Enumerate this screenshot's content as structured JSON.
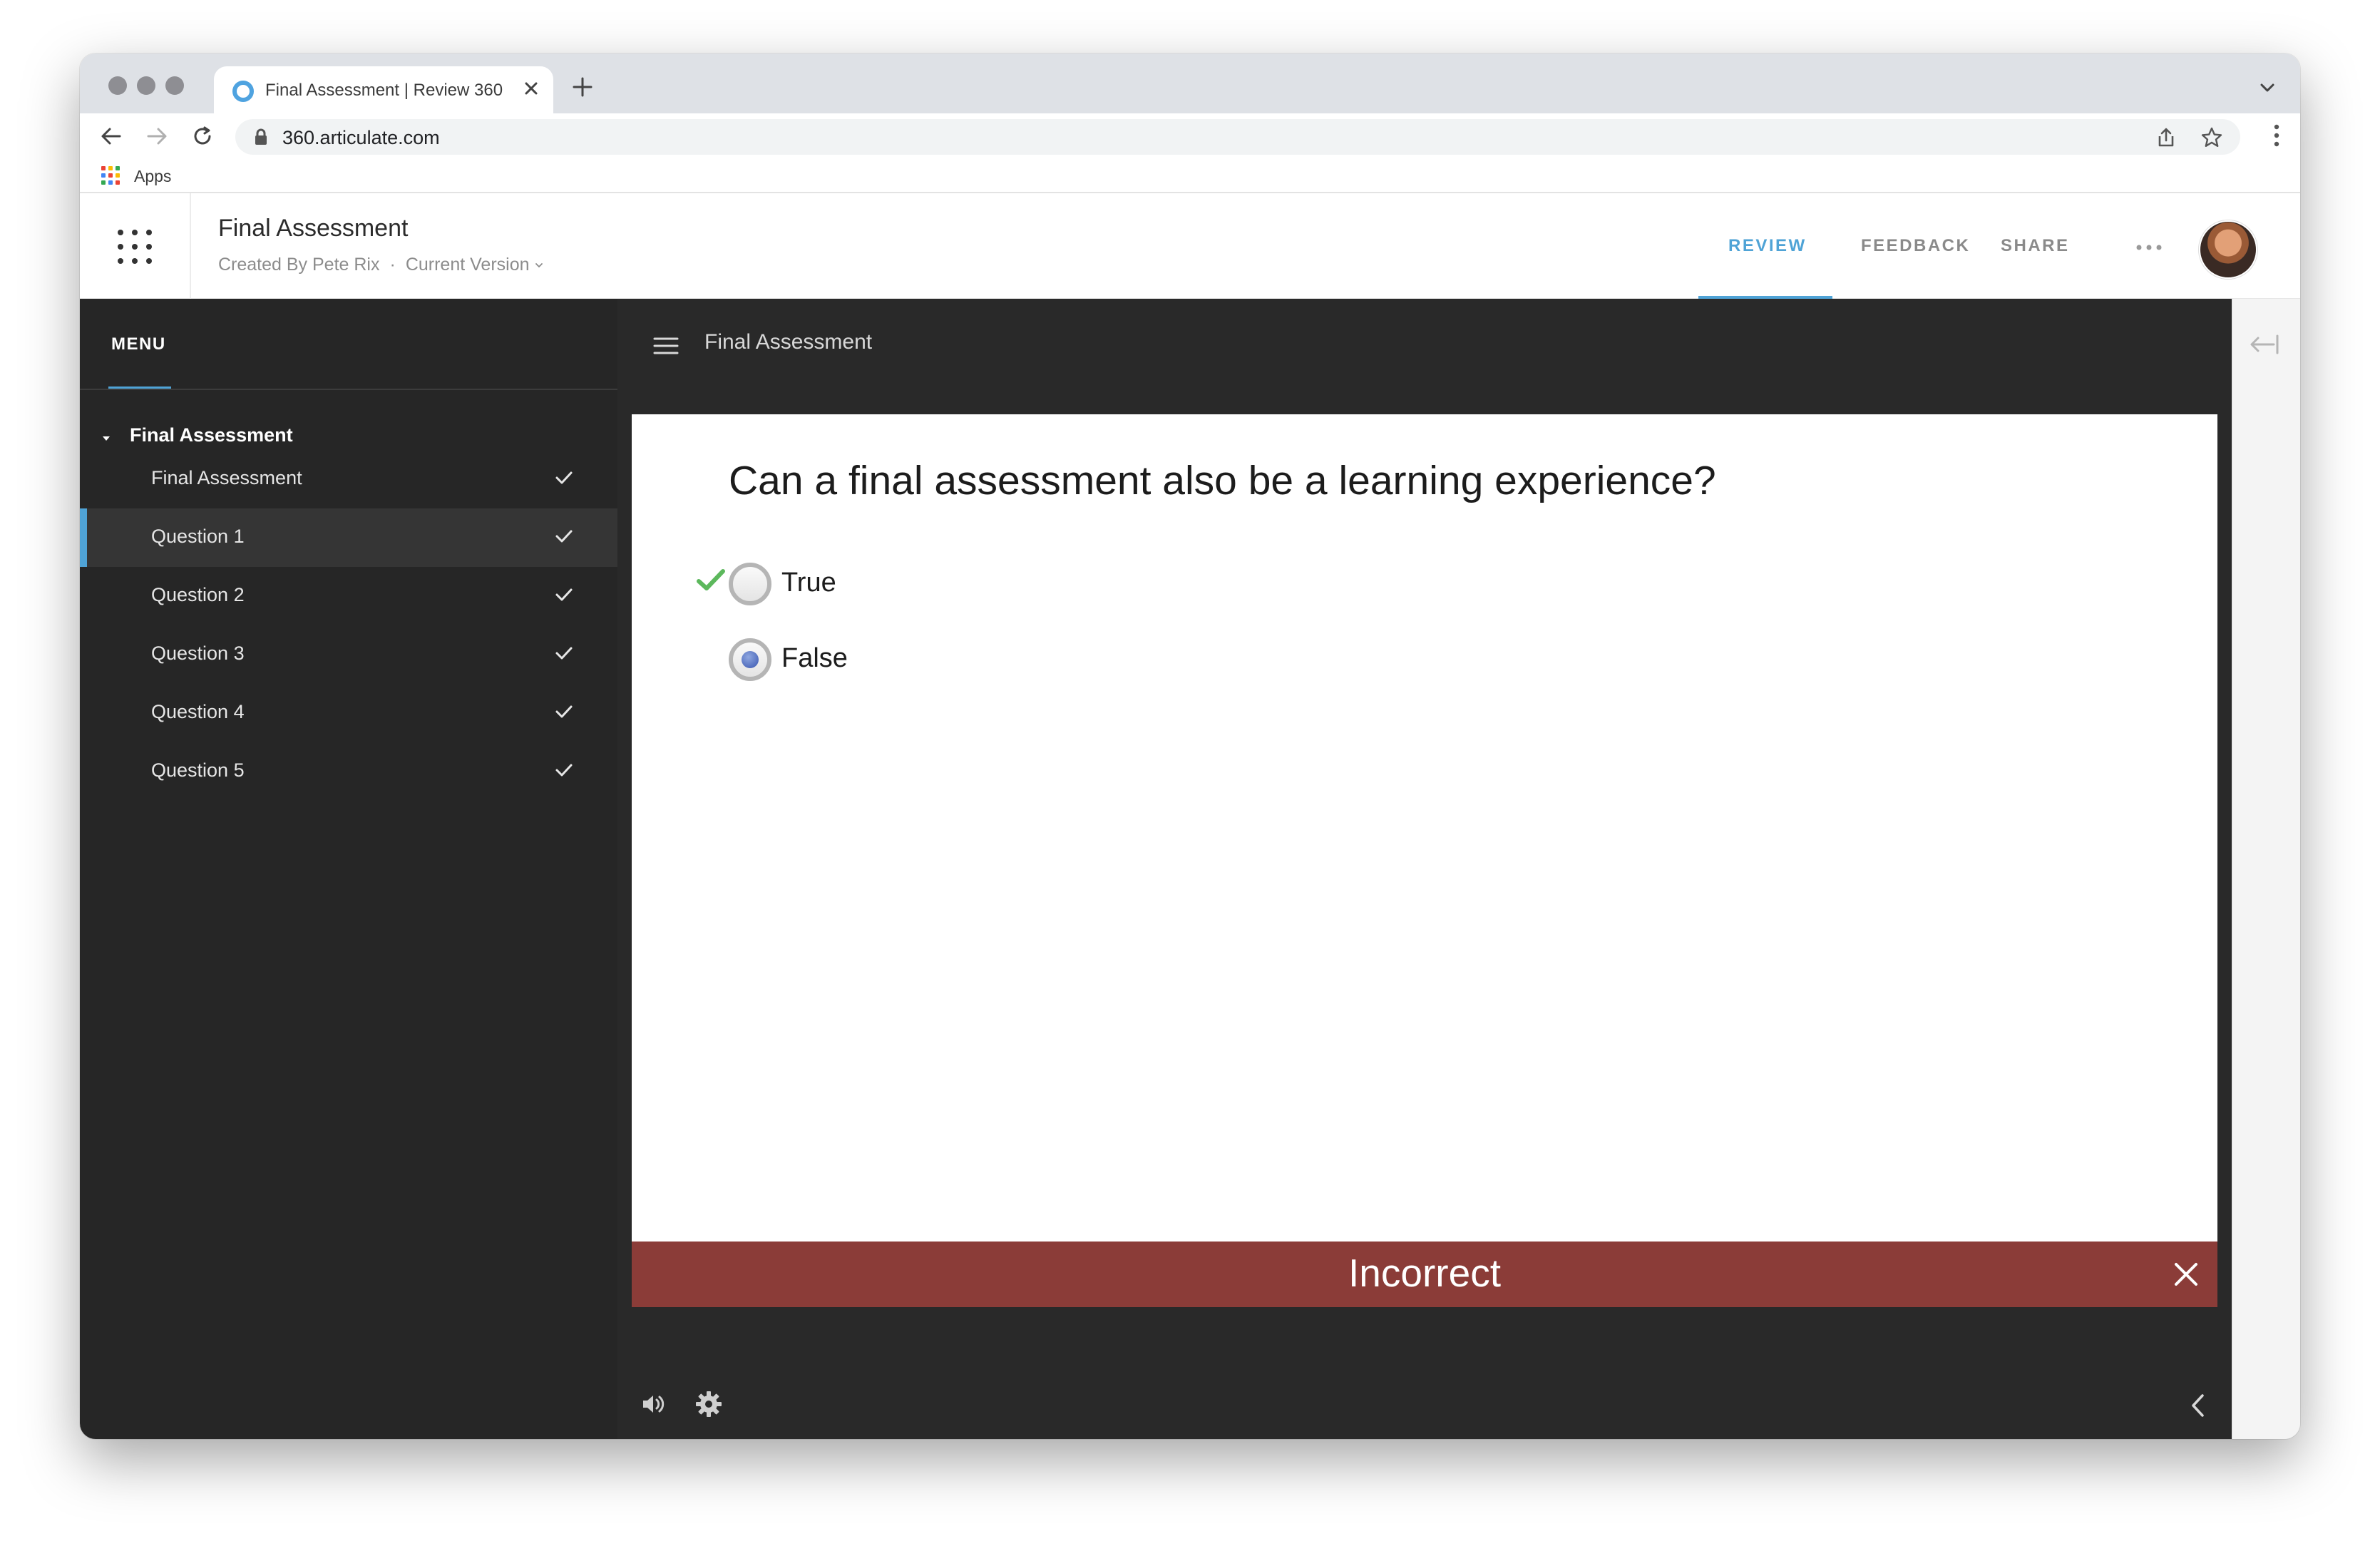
{
  "browser": {
    "tab_title": "Final Assessment | Review 360",
    "url": "360.articulate.com",
    "bookmarks_apps_label": "Apps"
  },
  "header": {
    "doc_title": "Final Assessment",
    "created_by": "Created By Pete Rix",
    "separator": "·",
    "version_label": "Current Version",
    "nav": [
      {
        "label": "REVIEW",
        "active": true
      },
      {
        "label": "FEEDBACK",
        "active": false
      },
      {
        "label": "SHARE",
        "active": false
      }
    ]
  },
  "sidebar": {
    "menu_label": "MENU",
    "section_title": "Final Assessment",
    "items": [
      {
        "label": "Final Assessment",
        "completed": true,
        "active": false
      },
      {
        "label": "Question 1",
        "completed": true,
        "active": true
      },
      {
        "label": "Question 2",
        "completed": true,
        "active": false
      },
      {
        "label": "Question 3",
        "completed": true,
        "active": false
      },
      {
        "label": "Question 4",
        "completed": true,
        "active": false
      },
      {
        "label": "Question 5",
        "completed": true,
        "active": false
      }
    ]
  },
  "player": {
    "title": "Final Assessment",
    "question": "Can a final assessment also be a learning experience?",
    "choices": [
      {
        "label": "True",
        "selected": false,
        "correct": true
      },
      {
        "label": "False",
        "selected": true,
        "correct": false
      }
    ],
    "feedback": "Incorrect"
  },
  "colors": {
    "accent": "#4fa3d6",
    "feedback_incorrect": "#8b3c38",
    "sidebar_bg": "#262626",
    "player_bg": "#292929",
    "correct_check": "#5cb85c"
  },
  "icons": {
    "grid": "grid-icon",
    "hamburger": "hamburger-icon",
    "volume": "volume-icon",
    "settings": "gear-icon",
    "prev": "chevron-left-icon",
    "next": "chevron-right-icon",
    "collapse": "collapse-panel-icon"
  }
}
